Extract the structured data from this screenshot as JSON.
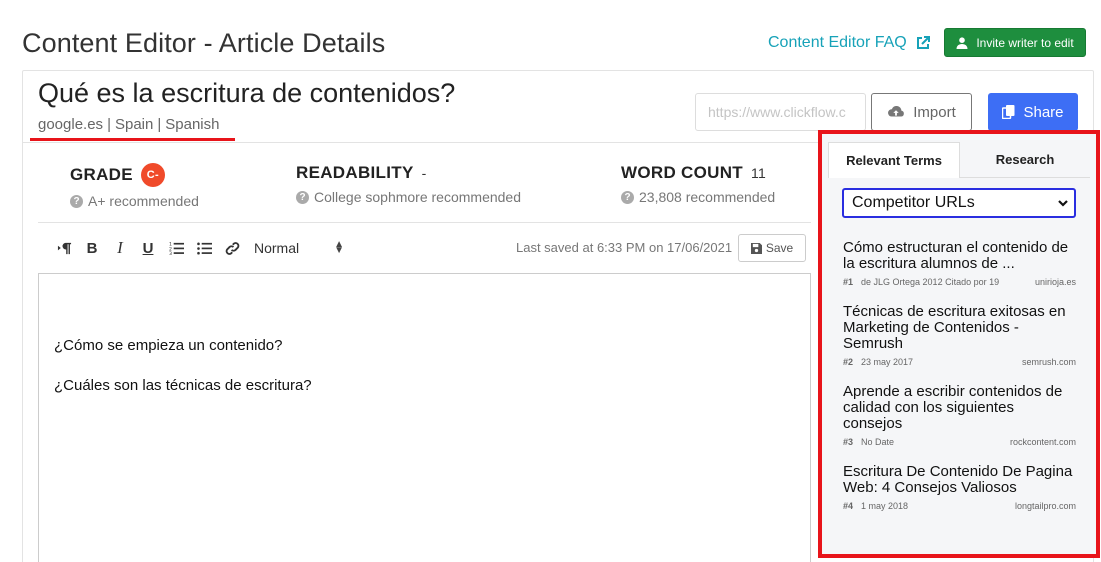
{
  "header": {
    "title": "Content Editor - Article Details",
    "faq_link": "Content Editor FAQ",
    "invite_button": "Invite writer to edit"
  },
  "article": {
    "title": "Qué es la escritura de contenidos?",
    "meta": [
      "google.es",
      "|",
      "Spain",
      "|",
      "Spanish"
    ],
    "url_placeholder": "https://www.clickflow.c",
    "import_label": "Import",
    "share_label": "Share"
  },
  "stats": {
    "grade": {
      "label": "GRADE",
      "value": "C-",
      "sub": "A+ recommended"
    },
    "readability": {
      "label": "READABILITY",
      "value": "-",
      "sub": "College sophmore recommended"
    },
    "word_count": {
      "label": "WORD COUNT",
      "value": "11",
      "sub": "23,808 recommended"
    }
  },
  "toolbar": {
    "format": "Normal",
    "saved_text": "Last saved at 6:33 PM on 17/06/2021",
    "save_label": "Save"
  },
  "editor": {
    "lines": [
      "¿Cómo se empieza un contenido?",
      "¿Cuáles son las técnicas de escritura?"
    ]
  },
  "side_panel": {
    "tabs": [
      {
        "label": "Relevant Terms",
        "active": true
      },
      {
        "label": "Research",
        "active": false
      }
    ],
    "select_value": "Competitor URLs",
    "results": [
      {
        "title": "Cómo estructuran el contenido de la escritura alumnos de ...",
        "rank": "#1",
        "info": "de JLG Ortega 2012 Citado por 19",
        "domain": "unirioja.es"
      },
      {
        "title": "Técnicas de escritura exitosas en Marketing de Contenidos - Semrush",
        "rank": "#2",
        "info": "23 may 2017",
        "domain": "semrush.com"
      },
      {
        "title": "Aprende a escribir contenidos de calidad con los siguientes consejos",
        "rank": "#3",
        "info": "No Date",
        "domain": "rockcontent.com"
      },
      {
        "title": "Escritura De Contenido De Pagina Web: 4 Consejos Valiosos",
        "rank": "#4",
        "info": "1 may 2018",
        "domain": "longtailpro.com"
      }
    ]
  },
  "colors": {
    "accent_teal": "#17a2b8",
    "invite_green": "#1e8e3e",
    "share_blue": "#3d6ef5",
    "highlight_red": "#e8141a",
    "grade_badge": "#f04a2a"
  }
}
